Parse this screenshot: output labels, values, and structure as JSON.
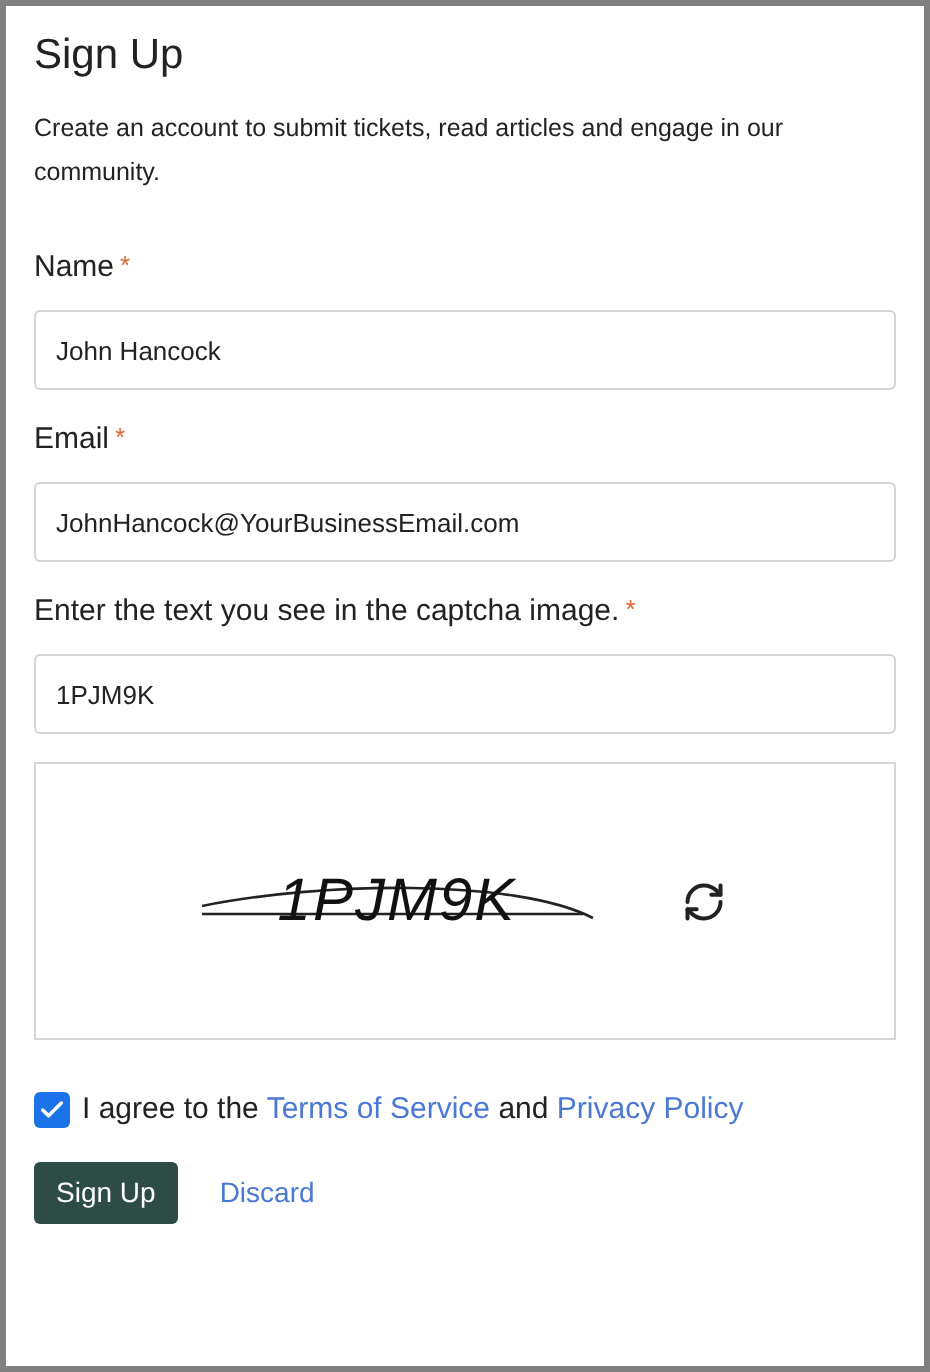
{
  "title": "Sign Up",
  "intro": "Create an account to submit tickets, read articles and engage in our community.",
  "fields": [
    {
      "label": "Name",
      "required": true,
      "value": "John Hancock"
    },
    {
      "label": "Email",
      "required": true,
      "value": "JohnHancock@YourBusinessEmail.com"
    },
    {
      "label": "Enter the text you see in the captcha image.",
      "required": true,
      "value": "1PJM9K"
    }
  ],
  "required_mark": "*",
  "captcha": {
    "text": "1PJM9K"
  },
  "agree": {
    "checked": true,
    "text": "I agree to the",
    "terms_link": "Terms of Service",
    "joiner": "and",
    "privacy_link": "Privacy Policy"
  },
  "buttons": {
    "submit": "Sign Up",
    "discard": "Discard"
  }
}
